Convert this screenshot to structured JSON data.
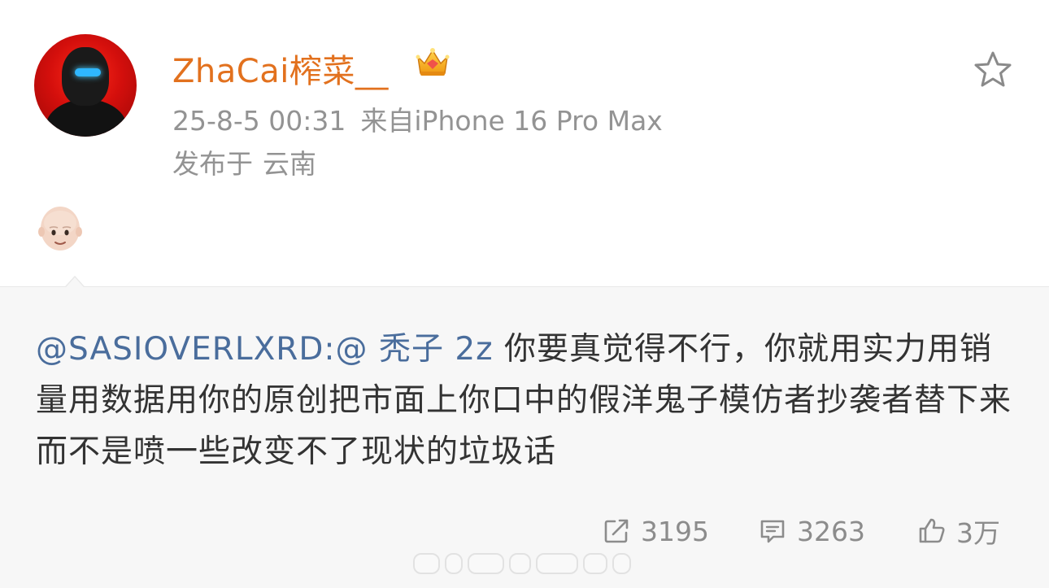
{
  "post": {
    "author": "ZhaCai榨菜__",
    "timestamp": "25-8-5 00:31",
    "source": "来自iPhone 16 Pro Max",
    "location_prefix": "发布于",
    "location": "云南",
    "badge_icon": "vip-crown-icon",
    "favorite_icon": "star-outline-icon",
    "body_emoji": "bald-person-emoji"
  },
  "repost": {
    "mention": "@SASIOVERLXRD:@ 秃子 2z",
    "text": " 你要真觉得不行，你就用实力用销量用数据用你的原创把市面上你口中的假洋鬼子模仿者抄袭者替下来  而不是喷一些改变不了现状的垃圾话"
  },
  "actions": {
    "repost_count": "3195",
    "comment_count": "3263",
    "like_count": "3万",
    "repost_icon": "share-icon",
    "comment_icon": "comment-icon",
    "like_icon": "thumbs-up-icon"
  },
  "colors": {
    "username": "#e2711e",
    "mention": "#4a6d9c",
    "meta": "#939393",
    "repost_bg": "#f7f7f7"
  }
}
